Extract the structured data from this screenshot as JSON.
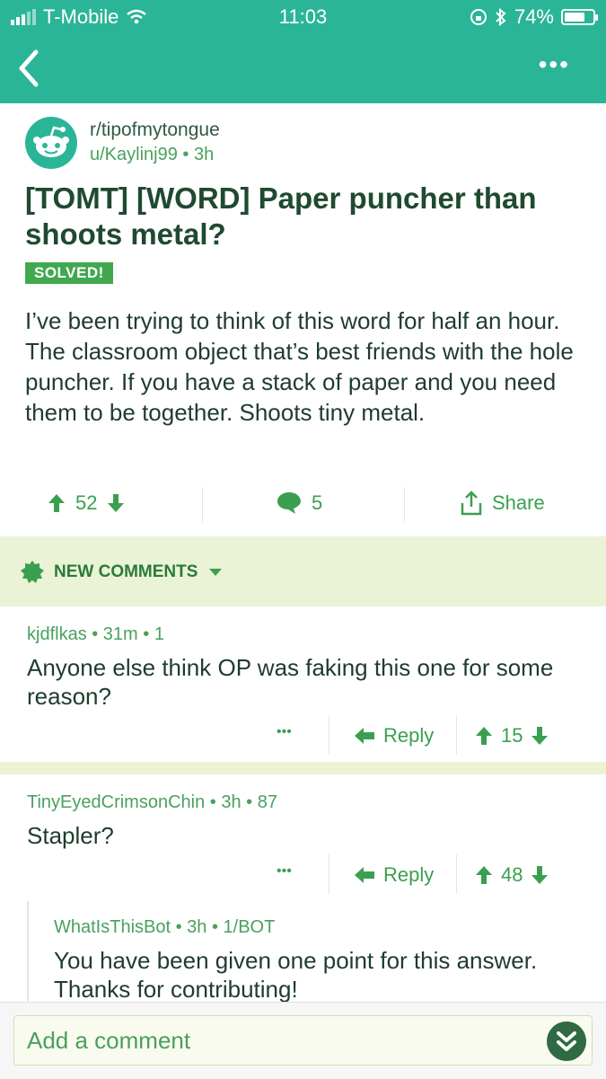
{
  "status": {
    "carrier": "T-Mobile",
    "time": "11:03",
    "battery": "74%",
    "battery_fraction": 0.74
  },
  "nav": {
    "back_icon": "chevron-left-icon",
    "more_icon": "more-horizontal-icon"
  },
  "post": {
    "subreddit": "r/tipofmytongue",
    "meta": "u/Kaylinj99 • 3h",
    "title": "[TOMT] [WORD] Paper puncher than shoots metal?",
    "flair": "SOLVED!",
    "body": "I’ve been trying to think of this word for half an hour. The classroom object that’s best friends with the hole puncher. If you have a stack of paper and you need them to be together. Shoots tiny metal.",
    "votes": "52",
    "comments": "5",
    "share_label": "Share"
  },
  "new_comments": {
    "label": "NEW COMMENTS"
  },
  "comments": [
    {
      "meta": "kjdflkas • 31m • 1",
      "text": "Anyone else think OP was faking this one for some reason?",
      "more": "•••",
      "reply": "Reply",
      "votes": "15"
    },
    {
      "meta": "TinyEyedCrimsonChin • 3h • 87",
      "text": "Stapler?",
      "more": "•••",
      "reply": "Reply",
      "votes": "48"
    },
    {
      "meta": "WhatIsThisBot • 3h • 1/BOT",
      "text": "You have been given one point for this answer. Thanks for contributing!"
    }
  ],
  "composer": {
    "placeholder": "Add a comment"
  },
  "colors": {
    "header": "#2bb597",
    "accent": "#3aa04f",
    "flair": "#42a84f",
    "banner": "#eaf3d6"
  }
}
